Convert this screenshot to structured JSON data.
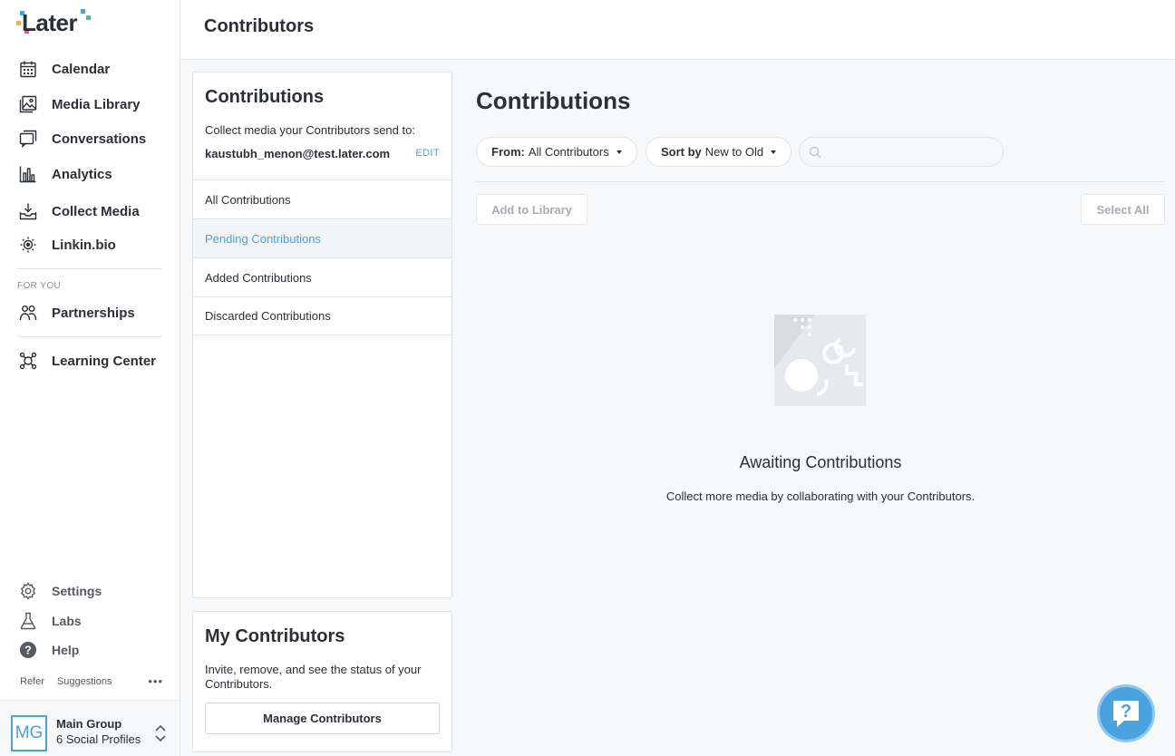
{
  "brand": {
    "name": "Later",
    "accent": "#4aa3df"
  },
  "topbar": {
    "title": "Contributors"
  },
  "sidebar": {
    "items": [
      {
        "label": "Calendar",
        "icon": "calendar-icon"
      },
      {
        "label": "Media Library",
        "icon": "image-icon"
      },
      {
        "label": "Conversations",
        "icon": "chat-icon"
      },
      {
        "label": "Analytics",
        "icon": "bar-chart-icon"
      },
      {
        "label": "Collect Media",
        "icon": "inbox-download-icon"
      },
      {
        "label": "Linkin.bio",
        "icon": "linkin-bio-icon"
      }
    ],
    "for_you_label": "FOR YOU",
    "for_you_items": [
      {
        "label": "Partnerships",
        "icon": "people-icon"
      }
    ],
    "learning": {
      "label": "Learning Center",
      "icon": "learning-icon"
    },
    "bottom_items": [
      {
        "label": "Settings",
        "icon": "gear-icon"
      },
      {
        "label": "Labs",
        "icon": "flask-icon"
      },
      {
        "label": "Help",
        "icon": "question-icon"
      }
    ],
    "refer_label": "Refer",
    "suggestions_label": "Suggestions",
    "more_label": "•••",
    "group": {
      "initials": "MG",
      "name": "Main Group",
      "profiles": "6 Social Profiles"
    }
  },
  "contributions_panel": {
    "title": "Contributions",
    "collect_text": "Collect media your Contributors send to:",
    "email": "kaustubh_menon@test.later.com",
    "edit_label": "EDIT",
    "list": [
      {
        "label": "All Contributions",
        "active": false
      },
      {
        "label": "Pending Contributions",
        "active": true
      },
      {
        "label": "Added Contributions",
        "active": false
      },
      {
        "label": "Discarded Contributions",
        "active": false
      }
    ]
  },
  "my_contributors": {
    "title": "My Contributors",
    "description": "Invite, remove, and see the status of your Contributors.",
    "button_label": "Manage Contributors"
  },
  "content": {
    "title": "Contributions",
    "filter_from_label": "From:",
    "filter_from_value": "All Contributors",
    "sort_label": "Sort by",
    "sort_value": "New to Old",
    "search_placeholder": "",
    "add_to_library_label": "Add to Library",
    "select_all_label": "Select All",
    "empty_title": "Awaiting Contributions",
    "empty_description": "Collect more media by collaborating with your Contributors."
  }
}
